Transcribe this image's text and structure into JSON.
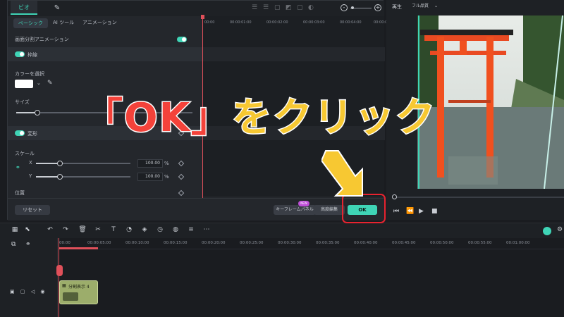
{
  "prop_panel": {
    "tabs": [
      "ビオ",
      "✎"
    ],
    "subtabs": [
      "ベーシック",
      "AI ツール",
      "アニメーション"
    ],
    "split_anim_label": "画面分割アニメーション",
    "border_section": "枠線",
    "color_label": "カラーを選択",
    "size_label": "サイズ",
    "transform_section": "変形",
    "scale_label": "スケール",
    "x_label": "X",
    "y_label": "Y",
    "x_value": "100.00",
    "y_value": "100.00",
    "percent": "%",
    "position_label": "位置",
    "reset_btn": "リセット",
    "keyframe_btn": "キーフレームパネル",
    "new_badge": "NEW",
    "advanced_btn": "高度編集",
    "ok_btn": "OK"
  },
  "ruler_top": [
    "00:00",
    "00:00:01:00",
    "00:00:02:00",
    "00:00:03:00",
    "00:00:04:00",
    "00:00:0"
  ],
  "preview": {
    "title": "再生",
    "quality": "フル品質"
  },
  "timeline": {
    "ruler": [
      "00:00",
      "00:00:05:00",
      "00:00:10:00",
      "00:00:15:00",
      "00:00:20:00",
      "00:00:25:00",
      "00:00:30:00",
      "00:00:35:00",
      "00:00:40:00",
      "00:00:45:00",
      "00:00:50:00",
      "00:00:55:00",
      "00:01:00:00"
    ],
    "clip_label": "分割表示 4"
  },
  "overlay": {
    "ok_text": "「OK」",
    "rest_text": "をクリック"
  },
  "colors": {
    "accent": "#3fd4b6",
    "highlight": "#e8232f",
    "arrow": "#f7c832"
  }
}
